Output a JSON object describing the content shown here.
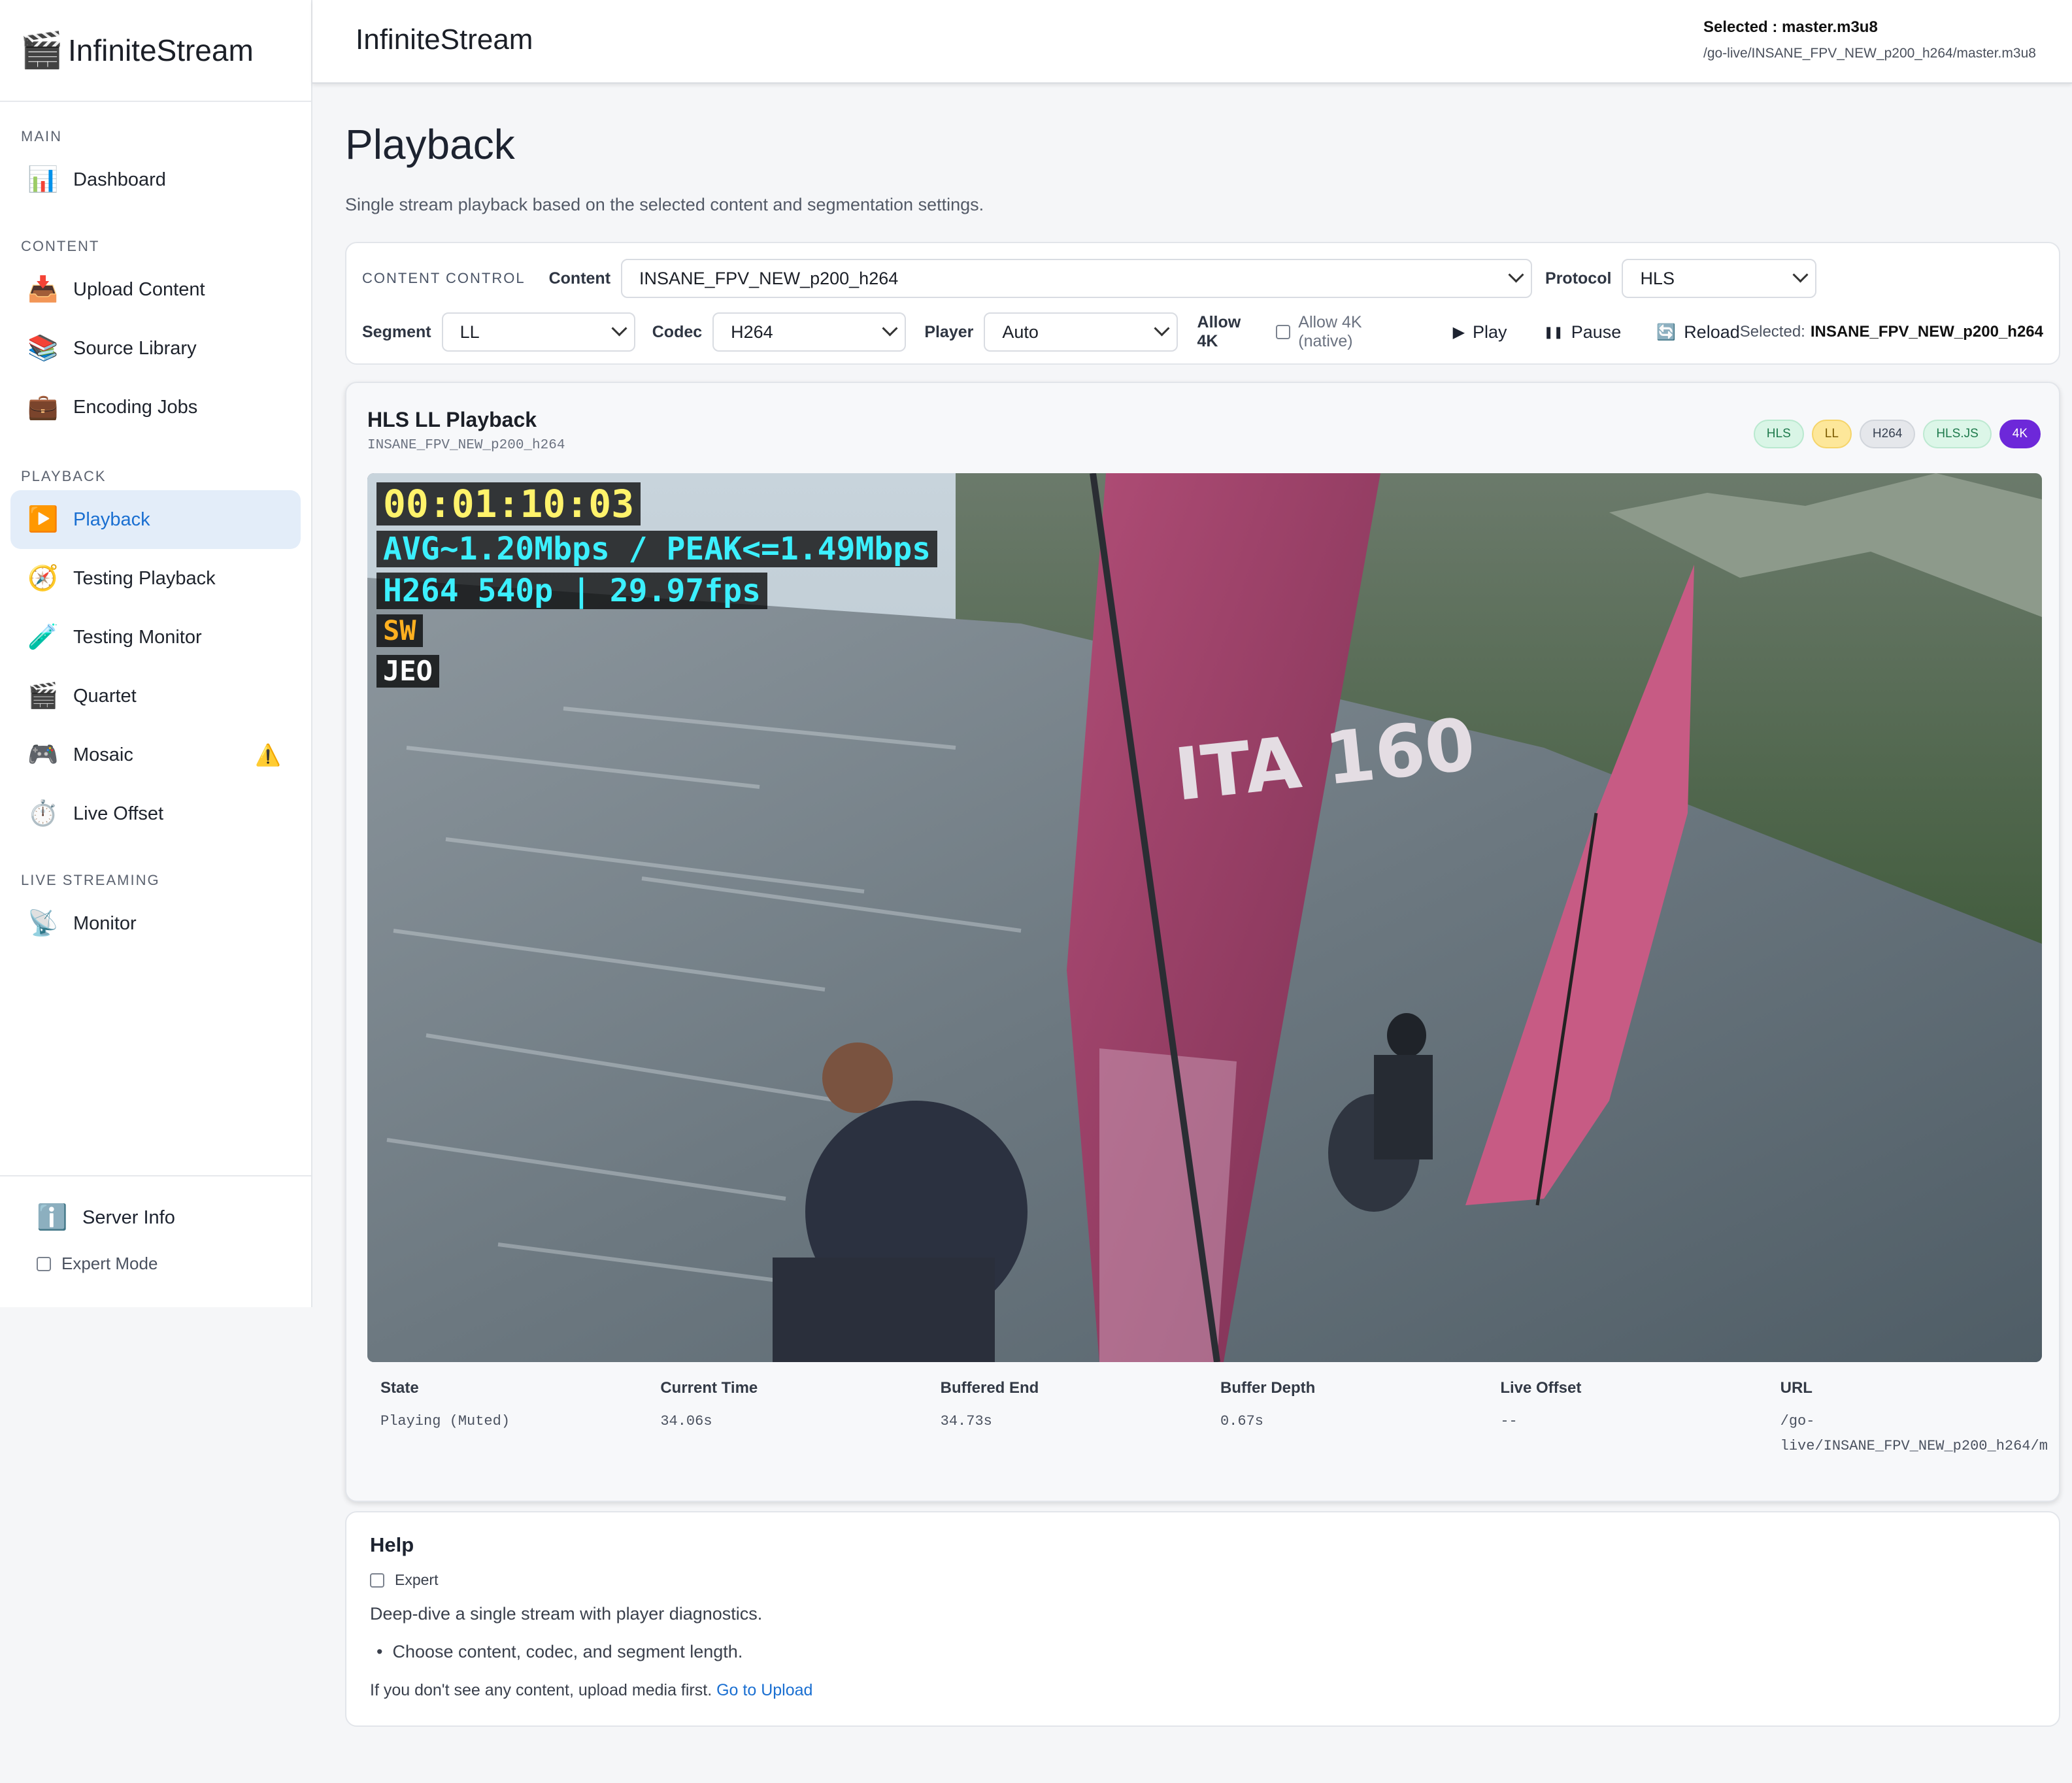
{
  "sidebar": {
    "brand": "InfiniteStream",
    "sections": [
      {
        "label": "MAIN",
        "items": [
          {
            "label": "Dashboard",
            "icon": "bar-chart-icon"
          }
        ]
      },
      {
        "label": "CONTENT",
        "items": [
          {
            "label": "Upload Content",
            "icon": "inbox-tray-icon"
          },
          {
            "label": "Source Library",
            "icon": "books-icon"
          },
          {
            "label": "Encoding Jobs",
            "icon": "briefcase-icon"
          }
        ]
      },
      {
        "label": "PLAYBACK",
        "items": [
          {
            "label": "Playback",
            "icon": "play-button-icon",
            "active": true
          },
          {
            "label": "Testing Playback",
            "icon": "compass-icon"
          },
          {
            "label": "Testing Monitor",
            "icon": "test-tube-icon"
          },
          {
            "label": "Quartet",
            "icon": "clapper-icon"
          },
          {
            "label": "Mosaic",
            "icon": "gamepad-icon",
            "warning": true
          },
          {
            "label": "Live Offset",
            "icon": "stopwatch-icon"
          }
        ]
      },
      {
        "label": "LIVE STREAMING",
        "items": [
          {
            "label": "Monitor",
            "icon": "satellite-icon"
          }
        ]
      }
    ],
    "server_info": "Server Info",
    "expert_mode": "Expert Mode"
  },
  "header": {
    "title": "InfiniteStream",
    "selected_label": "Selected : master.m3u8",
    "selected_path": "/go-live/INSANE_FPV_NEW_p200_h264/master.m3u8"
  },
  "page": {
    "title": "Playback",
    "subtitle": "Single stream playback based on the selected content and segmentation settings."
  },
  "controls": {
    "section_label": "CONTENT CONTROL",
    "content_label": "Content",
    "content_value": "INSANE_FPV_NEW_p200_h264",
    "protocol_label": "Protocol",
    "protocol_value": "HLS",
    "segment_label": "Segment",
    "segment_value": "LL",
    "codec_label": "Codec",
    "codec_value": "H264",
    "player_label": "Player",
    "player_value": "Auto",
    "allow4k_label": "Allow 4K",
    "allow4k_native": "Allow 4K (native)",
    "play": "Play",
    "pause": "Pause",
    "reload": "Reload",
    "selected_prefix": "Selected:",
    "selected_value": "INSANE_FPV_NEW_p200_h264"
  },
  "player": {
    "title": "HLS LL Playback",
    "subtitle": "INSANE_FPV_NEW_p200_h264",
    "badges": [
      {
        "label": "HLS",
        "bg": "#d9f5e6",
        "fg": "#1e7a4c",
        "border": "#b9e9cf"
      },
      {
        "label": "LL",
        "bg": "#fde79a",
        "fg": "#7a5a00",
        "border": "#f5d46a"
      },
      {
        "label": "H264",
        "bg": "#e5e7eb",
        "fg": "#374151",
        "border": "#d1d5db"
      },
      {
        "label": "HLS.JS",
        "bg": "#dcf6e8",
        "fg": "#1e7a4c",
        "border": "#bde9d1"
      },
      {
        "label": "4K",
        "bg": "#6d28d9",
        "fg": "#ffffff",
        "border": "#6d28d9"
      }
    ],
    "overlay": {
      "timecode": "00:01:10:03",
      "bitrate": "AVG~1.20Mbps / PEAK<=1.49Mbps",
      "format": "H264 540p | 29.97fps",
      "tag1": "SW",
      "tag2": "JEO",
      "sail_text": "ITA 160"
    },
    "stats": [
      {
        "label": "State",
        "value": "Playing (Muted)"
      },
      {
        "label": "Current Time",
        "value": "34.06s"
      },
      {
        "label": "Buffered End",
        "value": "34.73s"
      },
      {
        "label": "Buffer Depth",
        "value": "0.67s"
      },
      {
        "label": "Live Offset",
        "value": "--"
      },
      {
        "label": "URL",
        "value": "/go-\nlive/INSANE_FPV_NEW_p200_h264/m"
      }
    ]
  },
  "help": {
    "title": "Help",
    "expert": "Expert",
    "desc": "Deep-dive a single stream with player diagnostics.",
    "bullet": "Choose content, codec, and segment length.",
    "upload_text": "If you don't see any content, upload media first.",
    "upload_link": "Go to Upload"
  },
  "colors": {
    "accent": "#1a6fd1",
    "active_bg": "#e3edf9"
  }
}
